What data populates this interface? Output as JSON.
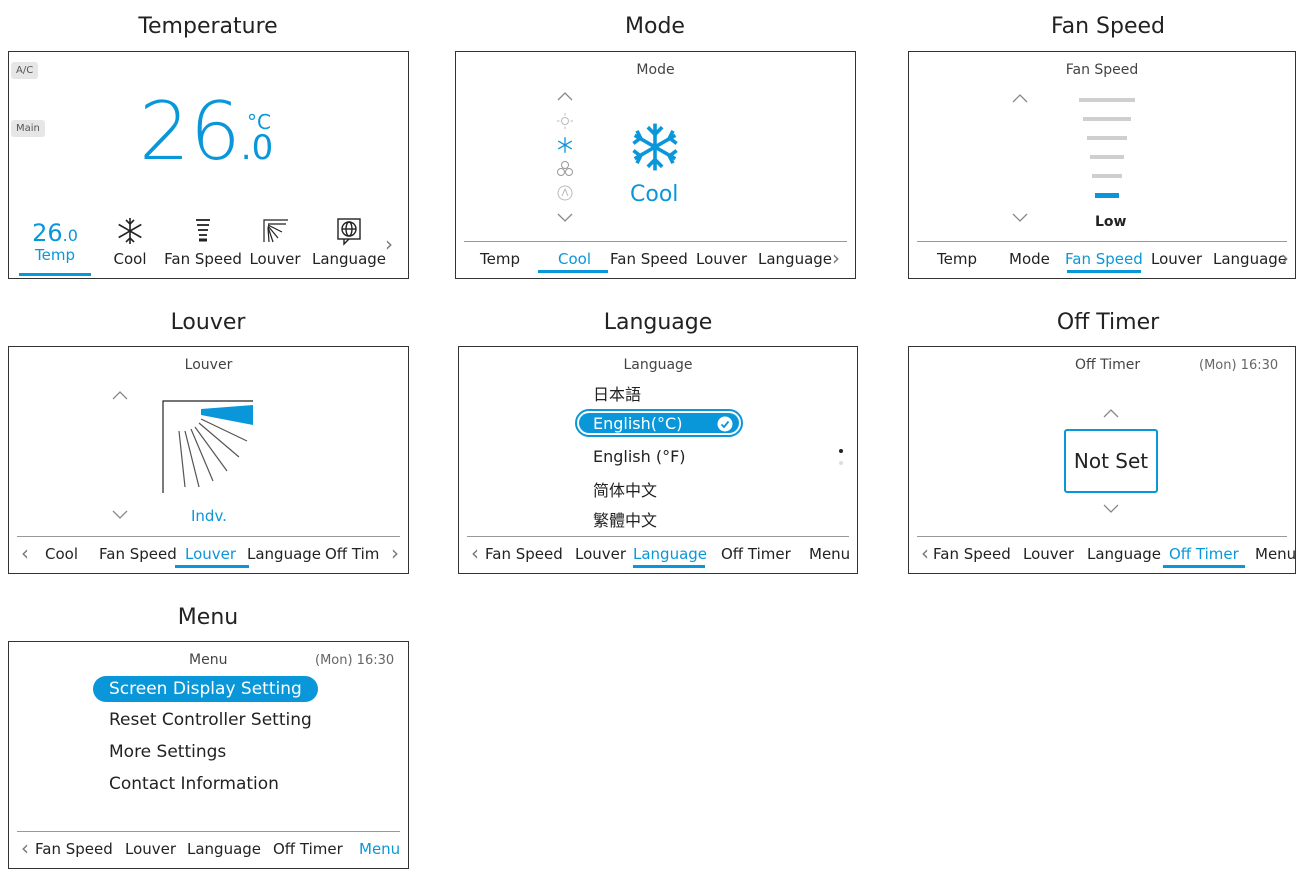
{
  "captions": {
    "temperature": "Temperature",
    "mode": "Mode",
    "fan_speed": "Fan Speed",
    "louver": "Louver",
    "language": "Language",
    "off_timer": "Off Timer",
    "menu": "Menu"
  },
  "temp_panel": {
    "badge_ac": "A/C",
    "badge_main": "Main",
    "big_int": "26",
    "big_dec": ".0",
    "unit": "°C",
    "tabs": [
      {
        "top_int": "26",
        "top_dec": ".0",
        "label": "Temp",
        "active": true
      },
      {
        "label": "Cool",
        "icon": "snowflake-icon"
      },
      {
        "label": "Fan Speed",
        "icon": "fan-bars-icon"
      },
      {
        "label": "Louver",
        "icon": "louver-icon"
      },
      {
        "label": "Language",
        "icon": "globe-icon"
      }
    ],
    "next_arrow": "›"
  },
  "mode_panel": {
    "title": "Mode",
    "mode_label": "Cool",
    "mode_icons": [
      "sun-icon",
      "snowflake-icon",
      "fan-icon",
      "auto-icon"
    ],
    "tabs": [
      "Temp",
      "Cool",
      "Fan Speed",
      "Louver",
      "Language"
    ],
    "active_tab": 1
  },
  "fan_panel": {
    "title": "Fan Speed",
    "level_label": "Low",
    "level": 1,
    "levels_total": 6,
    "tabs": [
      "Temp",
      "Mode",
      "Fan Speed",
      "Louver",
      "Language"
    ],
    "active_tab": 2
  },
  "louver_panel": {
    "title": "Louver",
    "setting_label": "Indv.",
    "tabs": [
      "Cool",
      "Fan Speed",
      "Louver",
      "Language",
      "Off Tim"
    ],
    "active_tab": 2
  },
  "language_panel": {
    "title": "Language",
    "options": [
      "日本語",
      "English(°C)",
      "English (°F)",
      "简体中文",
      "繁體中文"
    ],
    "selected": 1,
    "tabs": [
      "Fan Speed",
      "Louver",
      "Language",
      "Off Timer",
      "Menu"
    ],
    "active_tab": 2
  },
  "offtimer_panel": {
    "title": "Off Timer",
    "clock": "(Mon) 16:30",
    "value": "Not Set",
    "tabs": [
      "Fan Speed",
      "Louver",
      "Language",
      "Off Timer",
      "Menu"
    ],
    "active_tab": 3
  },
  "menu_panel": {
    "title": "Menu",
    "clock": "(Mon) 16:30",
    "items": [
      "Screen Display Setting",
      "Reset Controller Setting",
      "More Settings",
      "Contact Information"
    ],
    "selected": 0,
    "tabs": [
      "Fan Speed",
      "Louver",
      "Language",
      "Off Timer",
      "Menu"
    ],
    "active_tab": 4
  },
  "colors": {
    "accent": "#0a97d9",
    "border": "#333333",
    "bar_gray": "#cfcfcf"
  }
}
